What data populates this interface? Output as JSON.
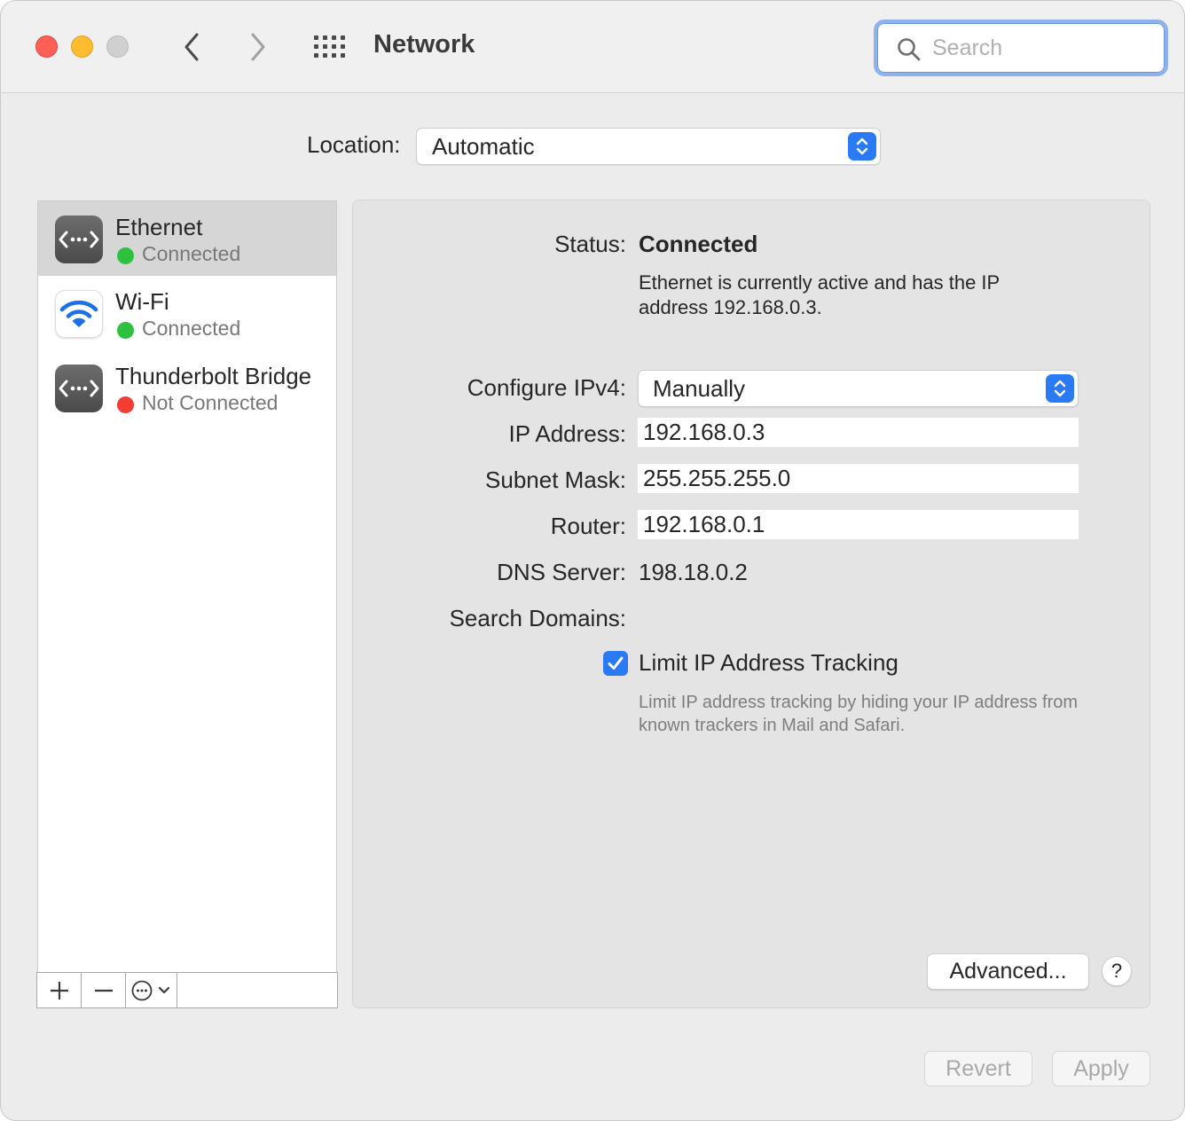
{
  "window": {
    "title": "Network",
    "search_placeholder": "Search"
  },
  "location": {
    "label": "Location:",
    "value": "Automatic"
  },
  "services": [
    {
      "name": "Ethernet",
      "status": "Connected",
      "status_color": "#2ec13f",
      "icon": "ethernet-icon",
      "selected": true
    },
    {
      "name": "Wi-Fi",
      "status": "Connected",
      "status_color": "#2ec13f",
      "icon": "wifi-icon",
      "selected": false
    },
    {
      "name": "Thunderbolt Bridge",
      "status": "Not Connected",
      "status_color": "#f23c34",
      "icon": "thunderbolt-bridge-icon",
      "selected": false
    }
  ],
  "toolbar": {
    "add_icon": "plus-icon",
    "remove_icon": "minus-icon",
    "action_icon": "ellipsis-circle-icon"
  },
  "detail": {
    "status_label": "Status:",
    "status_value": "Connected",
    "status_description": "Ethernet is currently active and has the IP address 192.168.0.3.",
    "configure_label": "Configure IPv4:",
    "configure_value": "Manually",
    "ip_label": "IP Address:",
    "ip_value": "192.168.0.3",
    "subnet_label": "Subnet Mask:",
    "subnet_value": "255.255.255.0",
    "router_label": "Router:",
    "router_value": "192.168.0.1",
    "dns_label": "DNS Server:",
    "dns_value": "198.18.0.2",
    "search_domains_label": "Search Domains:",
    "search_domains_value": "",
    "limit_tracking_label": "Limit IP Address Tracking",
    "limit_tracking_checked": true,
    "limit_tracking_description": "Limit IP address tracking by hiding your IP address from known trackers in Mail and Safari.",
    "advanced_label": "Advanced...",
    "help_label": "?"
  },
  "buttons": {
    "revert": "Revert",
    "apply": "Apply"
  },
  "colors": {
    "accent": "#2a7af5",
    "connected": "#2ec13f",
    "not_connected": "#f23c34"
  }
}
